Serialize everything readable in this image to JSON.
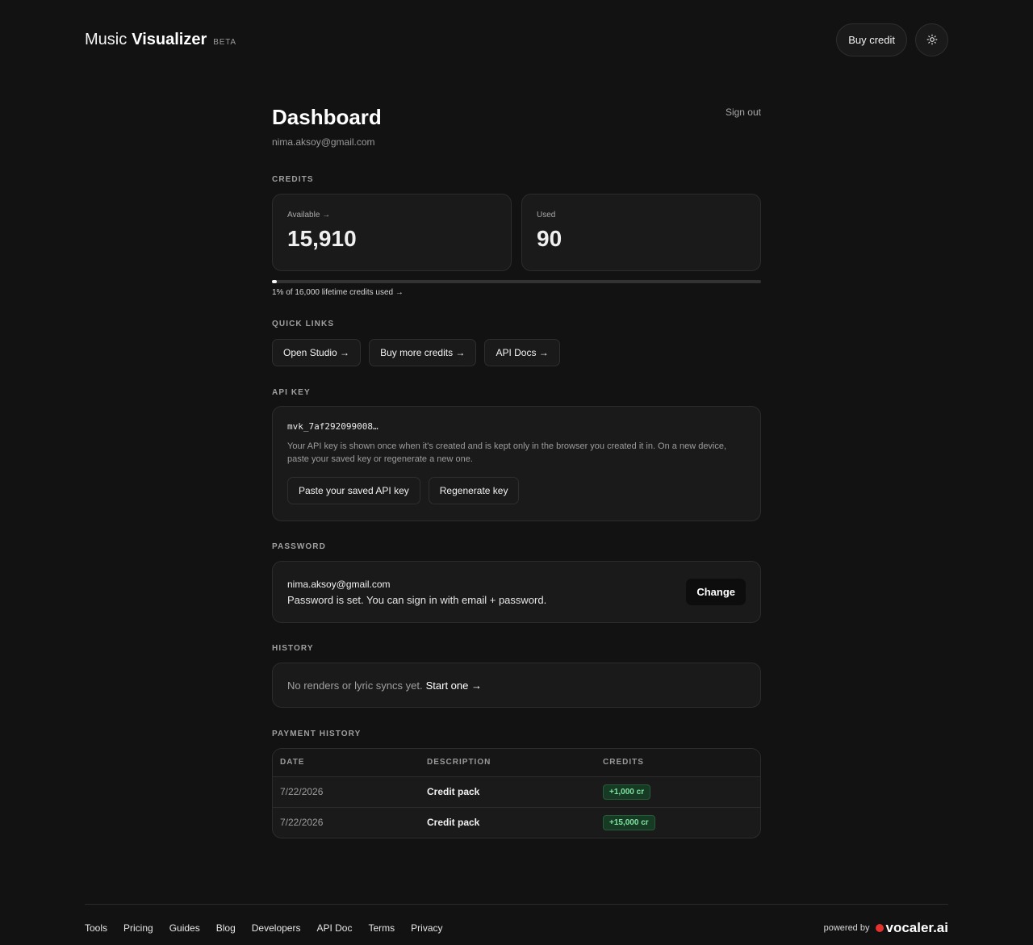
{
  "header": {
    "brand_light": "Music",
    "brand_bold": "Visualizer",
    "badge": "BETA",
    "buy_credit": "Buy credit",
    "theme_icon": "sun-icon"
  },
  "dashboard": {
    "title": "Dashboard",
    "email": "nima.aksoy@gmail.com",
    "sign_out": "Sign out"
  },
  "credits": {
    "section": "CREDITS",
    "available_label": "Available →",
    "available_value": "15,910",
    "used_label": "Used",
    "used_value": "90",
    "progress_fraction": 0.01,
    "progress_text": "1% of 16,000 lifetime credits used →"
  },
  "quick_links": {
    "section": "QUICK LINKS",
    "items": [
      "Open Studio →",
      "Buy more credits →",
      "API Docs →"
    ]
  },
  "api_key": {
    "section": "API KEY",
    "value": "mvk_7af292099008…",
    "note": "Your API key is shown once when it's created and is kept only in the browser you created it in. On a new device, paste your saved key or regenerate a new one.",
    "paste_button": "Paste your saved API key",
    "regenerate_button": "Regenerate key"
  },
  "password": {
    "section": "PASSWORD",
    "email": "nima.aksoy@gmail.com",
    "status": "Password is set. You can sign in with email + password.",
    "change_button": "Change"
  },
  "history": {
    "section": "HISTORY",
    "empty_text": "No renders or lyric syncs yet.",
    "start_link": "Start one →"
  },
  "payment_history": {
    "section": "PAYMENT HISTORY",
    "columns": [
      "DATE",
      "DESCRIPTION",
      "CREDITS"
    ],
    "rows": [
      {
        "date": "7/22/2026",
        "description": "Credit pack",
        "credits": "+1,000 cr"
      },
      {
        "date": "7/22/2026",
        "description": "Credit pack",
        "credits": "+15,000 cr"
      }
    ]
  },
  "footer": {
    "links": [
      "Tools",
      "Pricing",
      "Guides",
      "Blog",
      "Developers",
      "API Doc",
      "Terms",
      "Privacy"
    ],
    "powered_by": "powered by",
    "vocaler": "vocaler.ai"
  }
}
